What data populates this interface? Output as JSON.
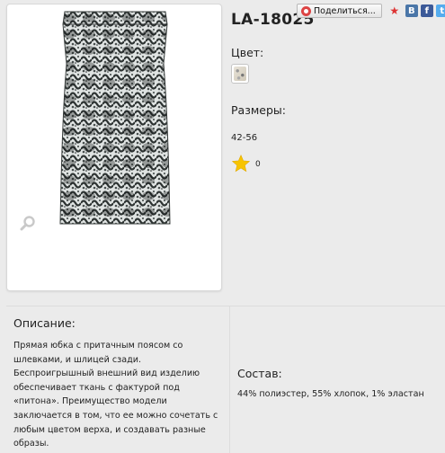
{
  "product": {
    "title": "LA-18025",
    "color_label": "Цвет:",
    "sizes_label": "Размеры:",
    "sizes_value": "42-56",
    "rating_count": "0",
    "description_heading": "Описание:",
    "description_lines": [
      "Прямая юбка с притачным поясом  со",
      "шлевками, и шлицей сзади.",
      "Беспроигрышный внешний вид изделию",
      "обеспечивает ткань  с фактурой под",
      "«питона». Преимущество модели",
      "заключается в том, что ее можно сочетать с",
      "любым цветом верха, и создавать разные",
      "образы."
    ],
    "composition_heading": "Состав:",
    "composition_value": "44% полиэстер, 55% хлопок, 1% эластан"
  },
  "share": {
    "button_label": "Поделиться...",
    "icons": [
      "share-icon",
      "moimir-icon",
      "vk-icon",
      "facebook-icon",
      "twitter-icon"
    ],
    "vk_glyph": "B",
    "fb_glyph": "f",
    "tw_glyph": "t",
    "moi_glyph": "★"
  },
  "colors": {
    "background": "#ebebeb",
    "star": "#f7c400",
    "vk": "#4a76a8",
    "facebook": "#3b5998",
    "twitter": "#55acee"
  }
}
